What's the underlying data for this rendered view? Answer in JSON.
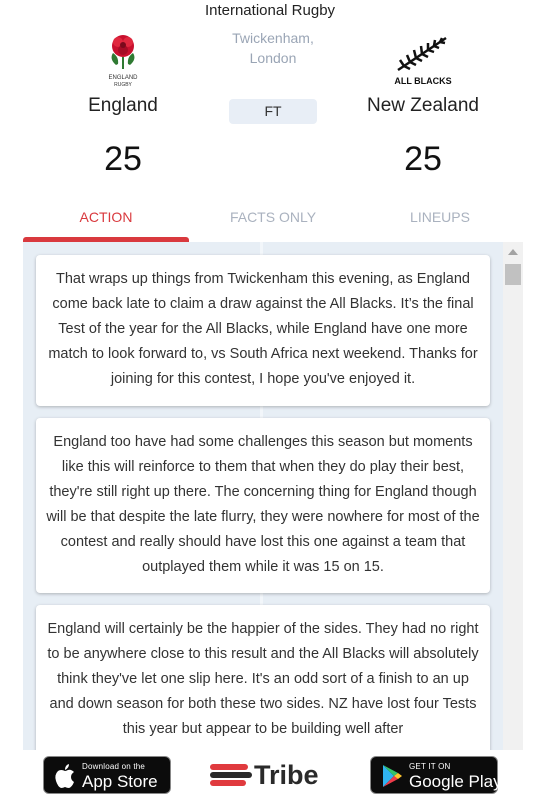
{
  "header": {
    "competition": "International Rugby",
    "venue_line1": "Twickenham,",
    "venue_line2": "London",
    "status": "FT"
  },
  "home": {
    "name": "England",
    "score": "25",
    "crest_text_1": "ENGLAND",
    "crest_text_2": "RUGBY",
    "crest_icon": "rose-icon"
  },
  "away": {
    "name": "New Zealand",
    "score": "25",
    "crest_text": "ALL BLACKS",
    "crest_icon": "silver-fern-icon"
  },
  "tabs": [
    {
      "label": "ACTION",
      "active": true
    },
    {
      "label": "FACTS ONLY",
      "active": false
    },
    {
      "label": "LINEUPS",
      "active": false
    }
  ],
  "feed": [
    {
      "text": "That wraps up things from Twickenham this evening, as England come back late to claim a draw against the All Blacks. It’s the final Test of the year for the All Blacks, while England have one more match to look forward to, vs South Africa next weekend. Thanks for joining for this contest, I hope you've enjoyed it."
    },
    {
      "text": "England too have had some challenges this season but moments like this will reinforce to them that when they do play their best, they're still right up there. The concerning thing for England though will be that despite the late flurry, they were nowhere for most of the contest and really should have lost this one against a team that outplayed them while it was 15 on 15."
    },
    {
      "text": "England will certainly be the happier of the sides. They had no right to be anywhere close to this result and the All Blacks will absolutely think they've let one slip here. It's an odd sort of a finish to an up and down season for both these two sides. NZ have lost four Tests this year but appear to be building well after"
    }
  ],
  "footer": {
    "appstore_small": "Download on the",
    "appstore_big": "App Store",
    "brand": "Tribe",
    "googleplay_small": "GET IT ON",
    "googleplay_big": "Google Play"
  },
  "colors": {
    "accent": "#d9393e",
    "feed_bg": "#e7eef5",
    "badge_bg": "#e8eef6",
    "muted": "#9aa5b5"
  }
}
